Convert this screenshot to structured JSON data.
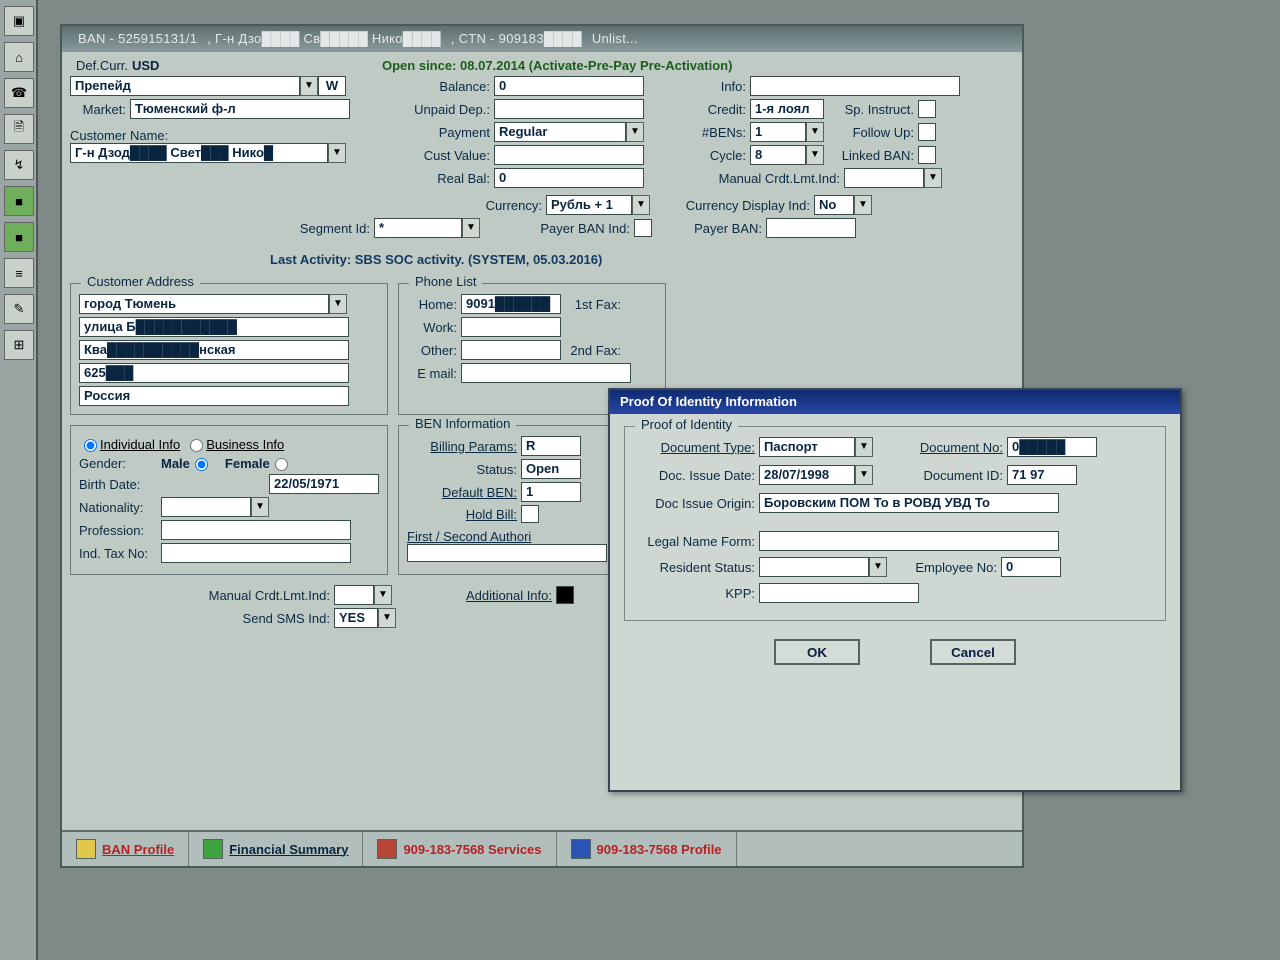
{
  "window": {
    "title_prefix": "BAN - 525915131/1",
    "title_mid": ", Г-н Дзо████ Св█████ Нико████",
    "title_ctn": ", CTN - 909183████",
    "title_suffix": " Unlist..."
  },
  "header": {
    "def_curr_lbl": "Def.Curr.",
    "def_curr": "USD",
    "open_since": "Open since: 08.07.2014 (Activate-Pre-Pay Pre-Activation)",
    "plan": "Препейд",
    "plan_code": "W",
    "market_lbl": "Market:",
    "market": "Тюменский ф-л",
    "cust_lbl": "Customer Name:",
    "cust": "Г-н Дзод████ Свет███ Нико█",
    "balance_lbl": "Balance:",
    "balance": "0",
    "unpaid_lbl": "Unpaid Dep.:",
    "payment_lbl": "Payment",
    "payment": "Regular",
    "custval_lbl": "Cust Value:",
    "realbal_lbl": "Real Bal:",
    "realbal": "0",
    "info_lbl": "Info:",
    "credit_lbl": "Credit:",
    "credit": "1-я лоял",
    "sp_lbl": "Sp. Instruct.",
    "bens_lbl": "#BENs:",
    "bens": "1",
    "follow_lbl": "Follow Up:",
    "cycle_lbl": "Cycle:",
    "cycle": "8",
    "linked_lbl": "Linked BAN:",
    "mcl_lbl": "Manual Crdt.Lmt.Ind:",
    "currency_lbl": "Currency:",
    "currency": "Рубль + 1",
    "cdi_lbl": "Currency Display Ind:",
    "cdi": "No",
    "seg_lbl": "Segment Id:",
    "seg": "*",
    "pbi_lbl": "Payer BAN Ind:",
    "pban_lbl": "Payer BAN:"
  },
  "activity": "Last Activity: SBS SOC activity. (SYSTEM, 05.03.2016)",
  "address": {
    "cap": "Customer Address",
    "l1": "город Тюмень",
    "l2": "улица Б███████████",
    "l3": "  Ква██████████нская",
    "l4": "625███",
    "l5": "Россия"
  },
  "phone": {
    "cap": "Phone List",
    "home_lbl": "Home:",
    "home": "9091██████",
    "work_lbl": "Work:",
    "other_lbl": "Other:",
    "email_lbl": "E mail:",
    "fax1_lbl": "1st Fax:",
    "fax2_lbl": "2nd Fax:"
  },
  "indiv": {
    "opt1": "Individual Info",
    "opt2": "Business Info",
    "gender_lbl": "Gender:",
    "male": "Male",
    "female": "Female",
    "birth_lbl": "Birth Date:",
    "birth": "22/05/1971",
    "nat_lbl": "Nationality:",
    "prof_lbl": "Profession:",
    "tax_lbl": "Ind. Tax No:",
    "mcl_lbl": "Manual Crdt.Lmt.Ind:",
    "sms_lbl": "Send SMS Ind:",
    "sms": "YES"
  },
  "ben": {
    "cap": "BEN Information",
    "bp_lbl": "Billing Params:",
    "bp": "R",
    "status_lbl": "Status:",
    "status": "Open",
    "def_lbl": "Default BEN:",
    "def": "1",
    "hold_lbl": "Hold Bill:",
    "fs_lbl": "First / Second  Authori",
    "add_lbl": "Additional Info:"
  },
  "tabs": {
    "t1": "BAN Profile",
    "t2": "Financial Summary",
    "t3": "909-183-7568 Services",
    "t4": "909-183-7568 Profile"
  },
  "dlg": {
    "title": "Proof Of Identity Information",
    "cap": "Proof of Identity",
    "dtype_lbl": "Document Type:",
    "dtype": "Паспорт",
    "dno_lbl": "Document No:",
    "dno": "0█████",
    "ddate_lbl": "Doc. Issue Date:",
    "ddate": "28/07/1998",
    "did_lbl": "Document ID:",
    "did": "71 97",
    "dorigin_lbl": "Doc Issue Origin:",
    "dorigin": "Боровским ПОМ То в РОВД УВД То",
    "ln_lbl": "Legal Name Form:",
    "rs_lbl": "Resident Status:",
    "emp_lbl": "Employee No:",
    "emp": "0",
    "kpp_lbl": "KPP:",
    "ok": "OK",
    "cancel": "Cancel"
  }
}
